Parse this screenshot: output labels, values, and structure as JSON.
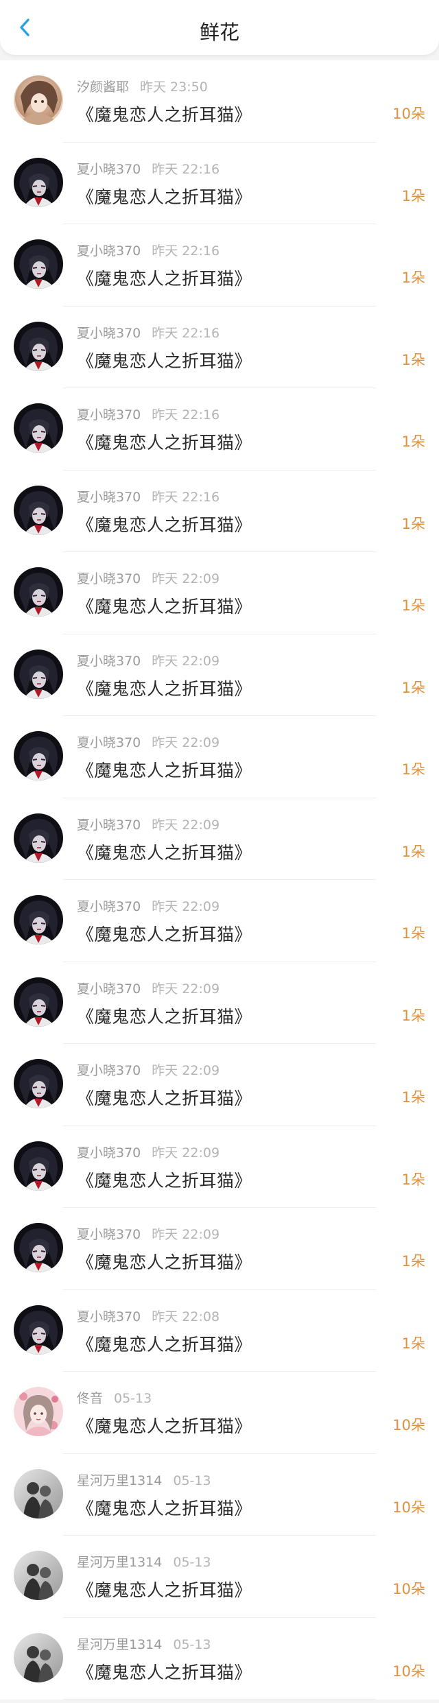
{
  "header": {
    "title": "鲜花"
  },
  "colors": {
    "accent": "#29a3e0",
    "count": "#e0913d"
  },
  "items": [
    {
      "user": "汐颜酱耶",
      "time": "昨天 23:50",
      "book": "《魔鬼恋人之折耳猫》",
      "count": "10朵",
      "avatar": "avatar-a"
    },
    {
      "user": "夏小晓370",
      "time": "昨天 22:16",
      "book": "《魔鬼恋人之折耳猫》",
      "count": "1朵",
      "avatar": "avatar-b"
    },
    {
      "user": "夏小晓370",
      "time": "昨天 22:16",
      "book": "《魔鬼恋人之折耳猫》",
      "count": "1朵",
      "avatar": "avatar-b"
    },
    {
      "user": "夏小晓370",
      "time": "昨天 22:16",
      "book": "《魔鬼恋人之折耳猫》",
      "count": "1朵",
      "avatar": "avatar-b"
    },
    {
      "user": "夏小晓370",
      "time": "昨天 22:16",
      "book": "《魔鬼恋人之折耳猫》",
      "count": "1朵",
      "avatar": "avatar-b"
    },
    {
      "user": "夏小晓370",
      "time": "昨天 22:16",
      "book": "《魔鬼恋人之折耳猫》",
      "count": "1朵",
      "avatar": "avatar-b"
    },
    {
      "user": "夏小晓370",
      "time": "昨天 22:09",
      "book": "《魔鬼恋人之折耳猫》",
      "count": "1朵",
      "avatar": "avatar-b"
    },
    {
      "user": "夏小晓370",
      "time": "昨天 22:09",
      "book": "《魔鬼恋人之折耳猫》",
      "count": "1朵",
      "avatar": "avatar-b"
    },
    {
      "user": "夏小晓370",
      "time": "昨天 22:09",
      "book": "《魔鬼恋人之折耳猫》",
      "count": "1朵",
      "avatar": "avatar-b"
    },
    {
      "user": "夏小晓370",
      "time": "昨天 22:09",
      "book": "《魔鬼恋人之折耳猫》",
      "count": "1朵",
      "avatar": "avatar-b"
    },
    {
      "user": "夏小晓370",
      "time": "昨天 22:09",
      "book": "《魔鬼恋人之折耳猫》",
      "count": "1朵",
      "avatar": "avatar-b"
    },
    {
      "user": "夏小晓370",
      "time": "昨天 22:09",
      "book": "《魔鬼恋人之折耳猫》",
      "count": "1朵",
      "avatar": "avatar-b"
    },
    {
      "user": "夏小晓370",
      "time": "昨天 22:09",
      "book": "《魔鬼恋人之折耳猫》",
      "count": "1朵",
      "avatar": "avatar-b"
    },
    {
      "user": "夏小晓370",
      "time": "昨天 22:09",
      "book": "《魔鬼恋人之折耳猫》",
      "count": "1朵",
      "avatar": "avatar-b"
    },
    {
      "user": "夏小晓370",
      "time": "昨天 22:09",
      "book": "《魔鬼恋人之折耳猫》",
      "count": "1朵",
      "avatar": "avatar-b"
    },
    {
      "user": "夏小晓370",
      "time": "昨天 22:08",
      "book": "《魔鬼恋人之折耳猫》",
      "count": "1朵",
      "avatar": "avatar-b"
    },
    {
      "user": "佟音",
      "time": "05-13",
      "book": "《魔鬼恋人之折耳猫》",
      "count": "10朵",
      "avatar": "avatar-c"
    },
    {
      "user": "星河万里1314",
      "time": "05-13",
      "book": "《魔鬼恋人之折耳猫》",
      "count": "10朵",
      "avatar": "avatar-d"
    },
    {
      "user": "星河万里1314",
      "time": "05-13",
      "book": "《魔鬼恋人之折耳猫》",
      "count": "10朵",
      "avatar": "avatar-d"
    },
    {
      "user": "星河万里1314",
      "time": "05-13",
      "book": "《魔鬼恋人之折耳猫》",
      "count": "10朵",
      "avatar": "avatar-d"
    }
  ]
}
